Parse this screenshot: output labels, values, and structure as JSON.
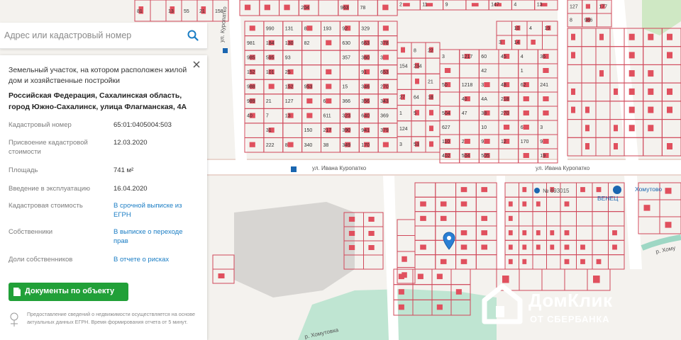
{
  "search": {
    "placeholder": "Адрес или кадастровый номер"
  },
  "panel": {
    "title": "Земельный участок, на котором расположен жилой дом и хозяйственные постройки",
    "address": "Российская Федерация, Сахалинская область, город Южно-Сахалинск, улица Флагманская, 4А",
    "rows": [
      {
        "key": "Кадастровый номер",
        "value": "65:01:0405004:503"
      },
      {
        "key": "Присвоение кадастровой стоимости",
        "value": "12.03.2020"
      },
      {
        "key": "Площадь",
        "value": "741 м²"
      },
      {
        "key": "Введение в эксплуатацию",
        "value": "16.04.2020"
      },
      {
        "key": "Кадастровая стоимость",
        "value": "В срочной выписке из ЕГРН"
      },
      {
        "key": "Собственники",
        "value": "В выписке о переходе прав"
      },
      {
        "key": "Доли собственников",
        "value": "В отчете о рисках"
      }
    ],
    "button_label": "Документы по объекту",
    "notice": "Предоставление сведений о недвижимости осуществляется на основе актуальных данных ЕГРН. Время формирования отчета от 5 минут."
  },
  "map": {
    "streets": [
      "ул. Ивана Куропатко",
      "ул. Ивана Куропатко",
      "ул. Куропатко",
      "р. Хомутовка",
      "р. Хому",
      "Хомутово"
    ],
    "bus_stop": "№ 693015",
    "parcel_labels": [
      "81",
      "13",
      "55",
      "21",
      "158",
      "204",
      "963",
      "78",
      "2",
      "11",
      "9",
      "147",
      "4",
      "13",
      "127",
      "8",
      "986",
      "177",
      "981",
      "985",
      "152",
      "988",
      "989",
      "40",
      "990",
      "184",
      "595",
      "101",
      "21",
      "7",
      "31",
      "222",
      "131",
      "130",
      "93",
      "25",
      "152",
      "127",
      "13",
      "8",
      "8",
      "82",
      "953",
      "150",
      "340",
      "193",
      "6",
      "611",
      "217",
      "38",
      "92",
      "630",
      "357",
      "15",
      "366",
      "323",
      "390",
      "349",
      "329",
      "663",
      "360",
      "91",
      "346",
      "356",
      "640",
      "941",
      "170",
      "378",
      "3",
      "653",
      "270",
      "343",
      "369",
      "379",
      "154",
      "27",
      "1",
      "124",
      "3",
      "8",
      "234",
      "64",
      "5",
      "53",
      "22",
      "21",
      "18",
      "3",
      "50",
      "504",
      "627",
      "110",
      "402",
      "1217",
      "1218",
      "40",
      "47",
      "2",
      "504",
      "60",
      "42",
      "3",
      "4A",
      "38",
      "10",
      "9",
      "505",
      "45",
      "48",
      "218",
      "270",
      "12",
      "4",
      "1",
      "62",
      "6",
      "170",
      "36",
      "241",
      "3",
      "9",
      "19",
      "3",
      "10",
      "14",
      "4",
      "19"
    ],
    "poi_bank": "ВЕНЕЦ",
    "colors": {
      "parcel_border": "#d0485a",
      "building": "#e0505e",
      "road": "#ffffff",
      "water": "#9ed7c4",
      "background": "#f4f2ee"
    }
  },
  "logo": {
    "name": "ДомКлик",
    "subtitle": "ОТ СБЕРБАНКА"
  }
}
